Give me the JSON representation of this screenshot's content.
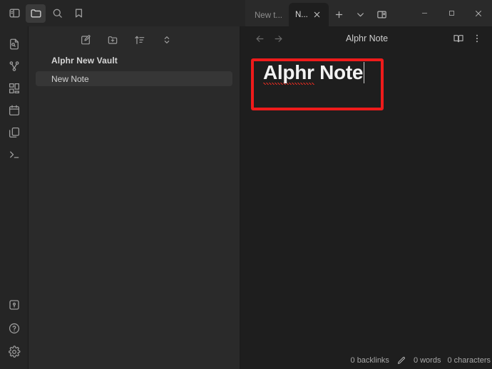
{
  "window": {
    "controls": [
      {
        "name": "minimize",
        "label": "−"
      },
      {
        "name": "maximize",
        "label": "□"
      },
      {
        "name": "close",
        "label": "✕"
      }
    ]
  },
  "left_toolbar": {
    "items": [
      {
        "name": "toggle-left-sidebar-icon",
        "label": "Toggle left sidebar",
        "active": false
      },
      {
        "name": "folder-icon",
        "label": "Files",
        "active": true
      },
      {
        "name": "search-icon",
        "label": "Search",
        "active": false
      },
      {
        "name": "bookmark-icon",
        "label": "Bookmarks",
        "active": false
      }
    ]
  },
  "tabs": {
    "items": [
      {
        "label": "New t...",
        "active": false
      },
      {
        "label": "N...",
        "active": true
      }
    ],
    "new_tab_label": "+",
    "tab_list_label": "⌄",
    "split_label": "Split right"
  },
  "ribbon": {
    "top_items": [
      {
        "name": "quick-switcher-icon",
        "label": "Open quick switcher"
      },
      {
        "name": "graph-view-icon",
        "label": "Open graph view"
      },
      {
        "name": "canvas-icon",
        "label": "Create new canvas"
      },
      {
        "name": "daily-note-icon",
        "label": "Open today's daily note"
      },
      {
        "name": "templates-icon",
        "label": "Insert template"
      },
      {
        "name": "terminal-icon",
        "label": "Open terminal"
      }
    ],
    "bottom_items": [
      {
        "name": "vault-switcher-icon",
        "label": "Open another vault"
      },
      {
        "name": "help-icon",
        "label": "Help"
      },
      {
        "name": "settings-icon",
        "label": "Settings"
      }
    ]
  },
  "explorer": {
    "toolbar": [
      {
        "name": "new-note-icon",
        "label": "New note"
      },
      {
        "name": "new-folder-icon",
        "label": "New folder"
      },
      {
        "name": "sort-order-icon",
        "label": "Change sort order"
      },
      {
        "name": "collapse-expand-icon",
        "label": "Expand all"
      }
    ],
    "vault_name": "Alphr New Vault",
    "files": [
      {
        "name": "New Note",
        "selected": true
      }
    ]
  },
  "note_header": {
    "back_label": "←",
    "forward_label": "→",
    "title": "Alphr Note",
    "reading_view_label": "Reading view",
    "more_options_label": "More options"
  },
  "editor": {
    "title_part_misspelled": "Alphr",
    "title_part_rest": " Note"
  },
  "statusbar": {
    "backlinks": "0 backlinks",
    "edit_icon_label": "Edit mode",
    "words": "0 words",
    "characters": "0 characters"
  },
  "colors": {
    "annotation": "#ee1b1b",
    "editor_bg": "#1e1e1e",
    "panel_bg": "#2a2a2a",
    "ribbon_bg": "#252525",
    "selected_row": "#363636"
  }
}
